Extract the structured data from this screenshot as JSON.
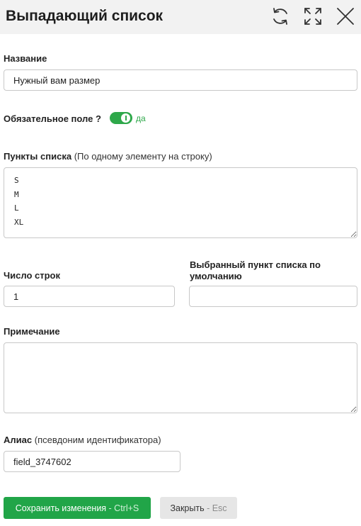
{
  "header": {
    "title": "Выпадающий список",
    "icons": [
      "refresh-icon",
      "expand-icon",
      "close-icon"
    ]
  },
  "form": {
    "name": {
      "label": "Название",
      "value": "Нужный вам размер"
    },
    "required": {
      "label": "Обязательное поле ?",
      "state_text": "да",
      "on": true
    },
    "items": {
      "label": "Пункты списка",
      "hint": "(По одному элементу на строку)",
      "value": "S\nM\nL\nXL"
    },
    "rows": {
      "label": "Число строк",
      "value": "1"
    },
    "default_item": {
      "label": "Выбранный пункт списка по умолчанию",
      "value": ""
    },
    "note": {
      "label": "Примечание",
      "value": ""
    },
    "alias": {
      "label": "Алиас",
      "hint": "(псевдоним идентификатора)",
      "value": "field_3747602"
    }
  },
  "footer": {
    "save_label": "Сохранить изменения",
    "save_shortcut": " - Ctrl+S",
    "close_label": "Закрыть",
    "close_shortcut": " - Esc"
  },
  "colors": {
    "accent_green": "#21a548",
    "header_bg": "#f2f2f2"
  }
}
